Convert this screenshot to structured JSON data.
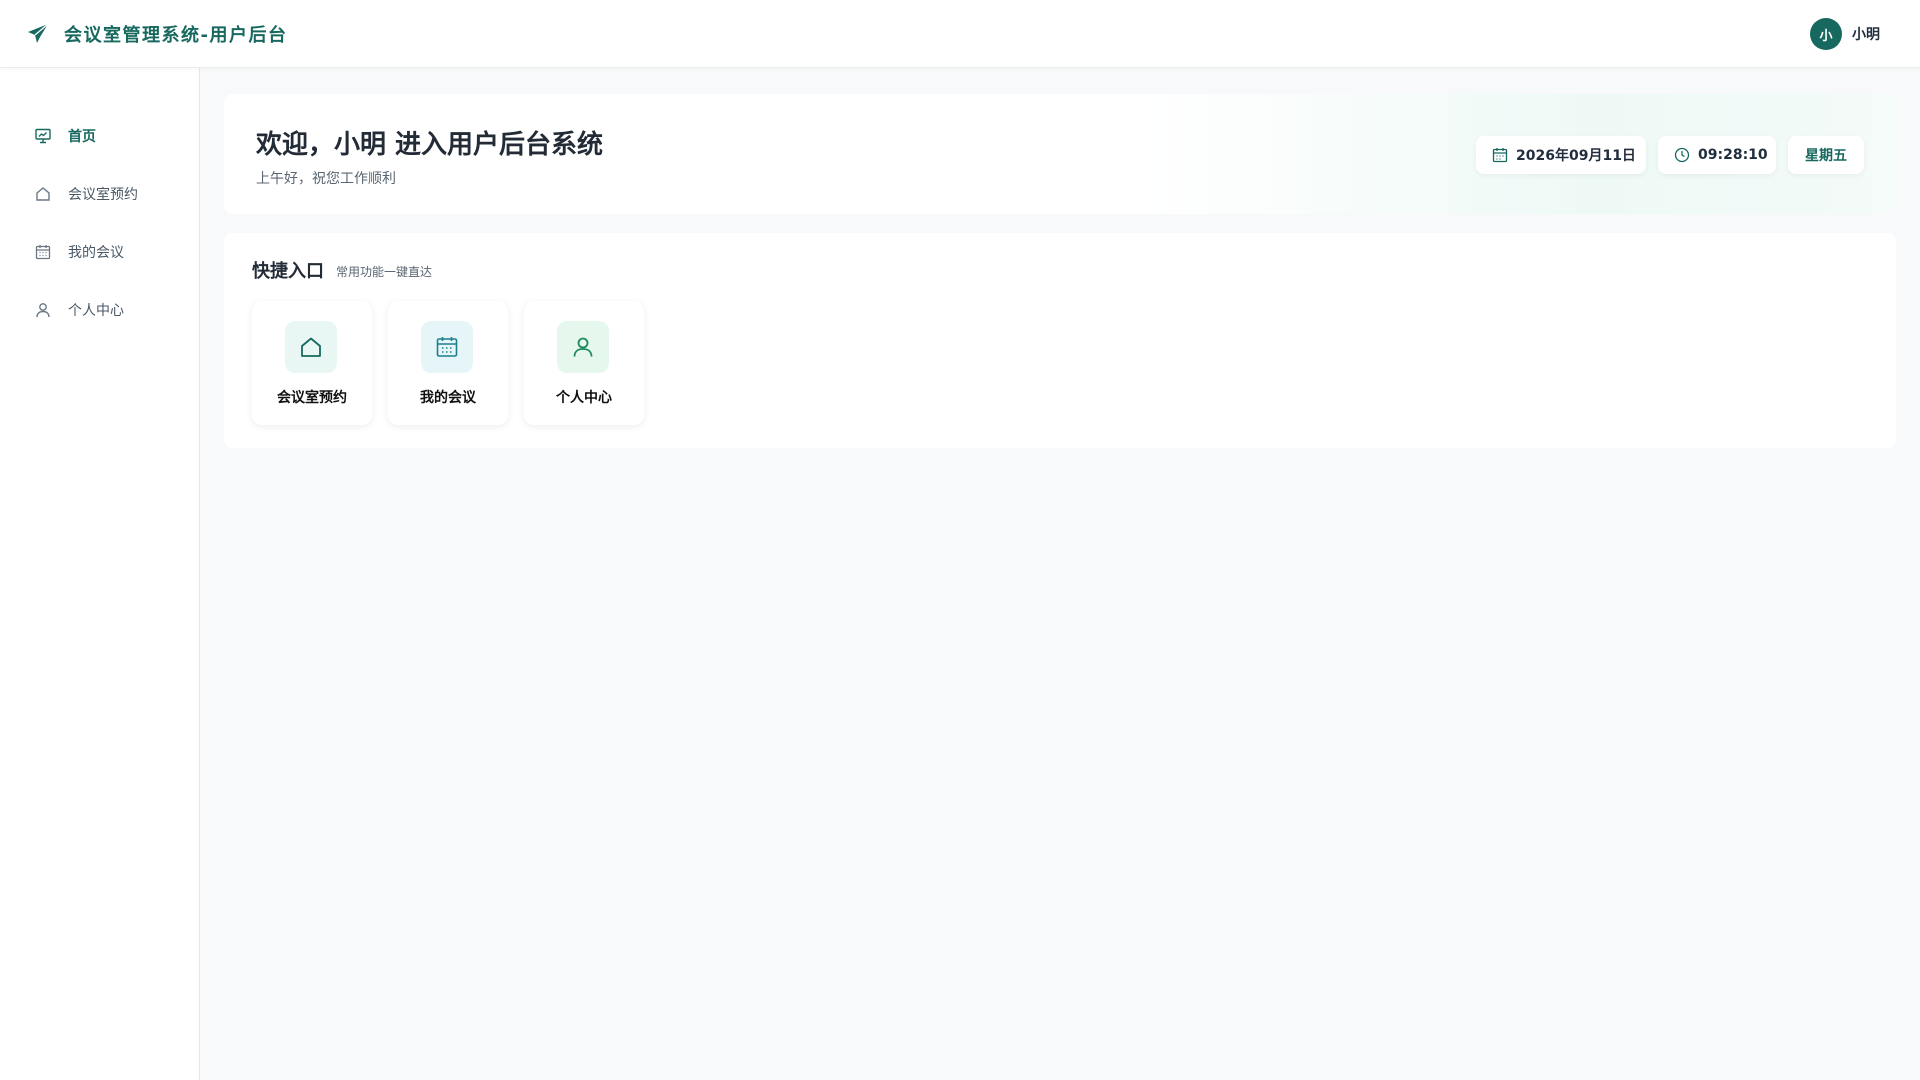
{
  "header": {
    "app_title": "会议室管理系统-用户后台",
    "brand_icon": "paper-plane-icon",
    "user": {
      "avatar_text": "小",
      "name": "小明"
    }
  },
  "sidebar": {
    "items": [
      {
        "label": "首页",
        "icon": "presentation-chart-icon",
        "active": true
      },
      {
        "label": "会议室预约",
        "icon": "home-icon",
        "active": false
      },
      {
        "label": "我的会议",
        "icon": "calendar-icon",
        "active": false
      },
      {
        "label": "个人中心",
        "icon": "user-icon",
        "active": false
      }
    ]
  },
  "welcome": {
    "title": "欢迎，小明 进入用户后台系统",
    "subtitle": "上午好，祝您工作顺利",
    "date": "2026年09月11日",
    "time": "09:28:10",
    "weekday": "星期五"
  },
  "quick_access": {
    "title": "快捷入口",
    "subtitle": "常用功能一键直达",
    "cards": [
      {
        "label": "会议室预约",
        "icon": "home-icon"
      },
      {
        "label": "我的会议",
        "icon": "calendar-icon"
      },
      {
        "label": "个人中心",
        "icon": "user-icon"
      }
    ]
  },
  "colors": {
    "primary": "#17695f",
    "background": "#f7f9fa",
    "card_icon_home_bg": "#e8f7f4",
    "card_icon_calendar_bg": "#e6f5f8",
    "card_icon_user_bg": "#e6f7ee"
  }
}
